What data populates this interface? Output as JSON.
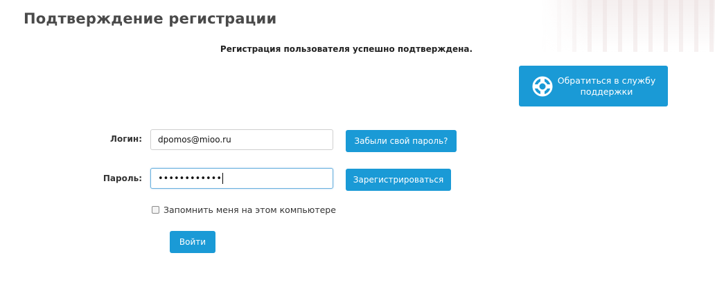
{
  "page": {
    "title": "Подтверждение регистрации",
    "success_message": "Регистрация пользователя успешно подтверждена."
  },
  "support": {
    "label": "Обратиться в службу поддержки",
    "icon": "lifebuoy-icon"
  },
  "form": {
    "login_label": "Логин:",
    "login_value": "dpomos@mioo.ru",
    "password_label": "Пароль:",
    "password_masked": "••••••••••••",
    "forgot_label": "Забыли свой пароль?",
    "register_label": "Зарегистрироваться",
    "remember_label": "Запомнить меня на этом компьютере",
    "remember_checked": false,
    "submit_label": "Войти"
  },
  "colors": {
    "accent": "#1a9ad6",
    "title": "#4a4a4a"
  }
}
